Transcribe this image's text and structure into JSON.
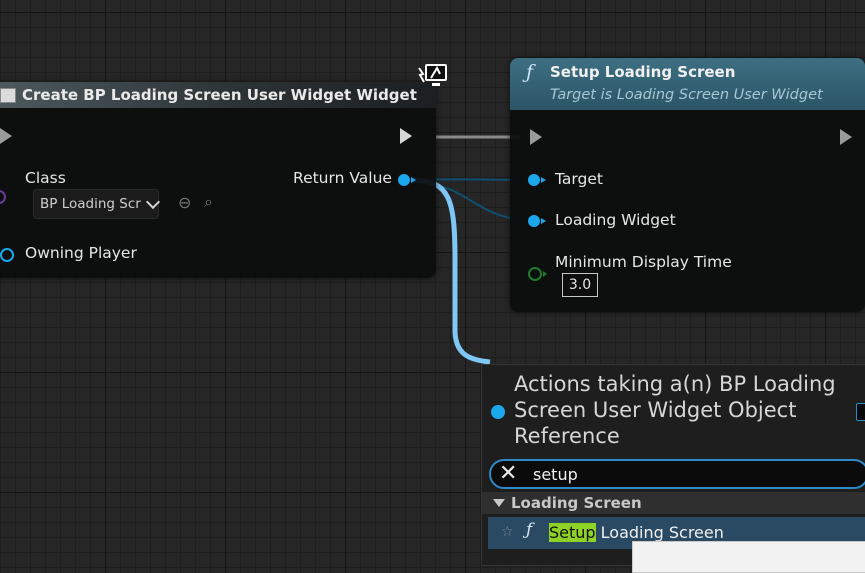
{
  "colors": {
    "object_pin": "#1aa7ec",
    "float_pin": "#1e7c2c",
    "class_pin": "#6a3aa0",
    "function_header": "#3e6f83",
    "search_highlight": "#8ed225",
    "selection": "#2a4a63"
  },
  "create_node": {
    "title": "Create BP Loading Screen User Widget Widget",
    "class_label": "Class",
    "class_value": "BP Loading Scr",
    "return_label": "Return Value",
    "owning_player_label": "Owning Player",
    "icons": [
      "widget-icon",
      "exec-in-icon",
      "exec-out-icon",
      "browse-back-icon",
      "search-icon",
      "latent-monitor-icon"
    ]
  },
  "setup_node": {
    "icon": "function-icon",
    "icon_glyph": "ƒ",
    "title": "Setup Loading Screen",
    "subtitle": "Target is Loading Screen User Widget",
    "target_label": "Target",
    "loading_widget_label": "Loading Widget",
    "min_display_label": "Minimum Display Time",
    "min_display_value": "3.0"
  },
  "action_menu": {
    "header": "Actions taking a(n) BP Loading Screen User Widget Object Reference",
    "search_value": "setup",
    "clear_glyph": "✕",
    "category": "Loading Screen",
    "result": {
      "star_glyph": "☆",
      "fn_glyph": "ƒ",
      "match": "Setup",
      "rest": " Loading Screen"
    }
  }
}
